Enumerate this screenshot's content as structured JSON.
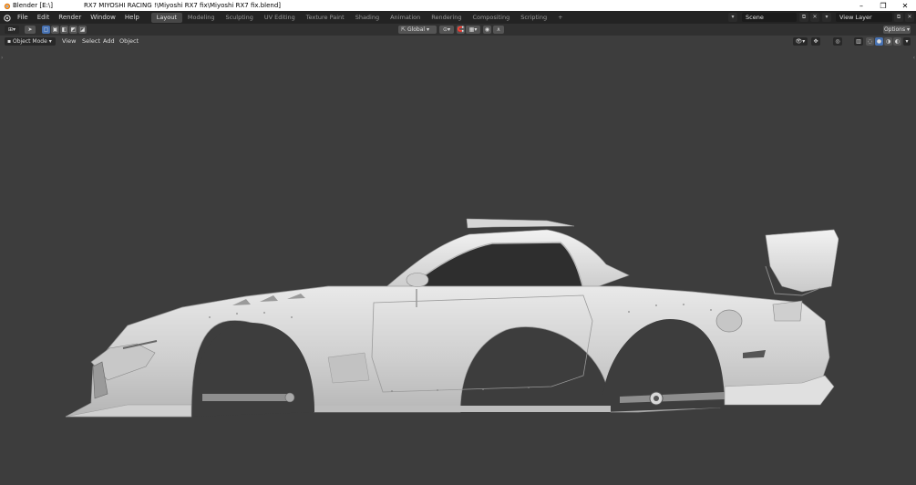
{
  "window": {
    "app_name": "Blender [E:\\]",
    "title": "RX7 MIYOSHI RACING !\\Miyoshi RX7 fix\\Miyoshi RX7 fix.blend]",
    "minimize": "–",
    "restore": "❐",
    "close": "✕"
  },
  "menu": [
    "File",
    "Edit",
    "Render",
    "Window",
    "Help"
  ],
  "workspaces": [
    "Layout",
    "Modeling",
    "Sculpting",
    "UV Editing",
    "Texture Paint",
    "Shading",
    "Animation",
    "Rendering",
    "Compositing",
    "Scripting"
  ],
  "active_workspace": "Layout",
  "add_workspace": "+",
  "scene": {
    "name": "Scene",
    "view_layer": "View Layer"
  },
  "header": {
    "transform_orientation": "Global",
    "options": "Options"
  },
  "viewport_header": {
    "mode": "Object Mode",
    "menus": [
      "View",
      "Select",
      "Add",
      "Object"
    ]
  },
  "colors": {
    "accent": "#4772b3",
    "viewport_bg": "#3d3d3d",
    "topbar_bg": "#232323"
  }
}
